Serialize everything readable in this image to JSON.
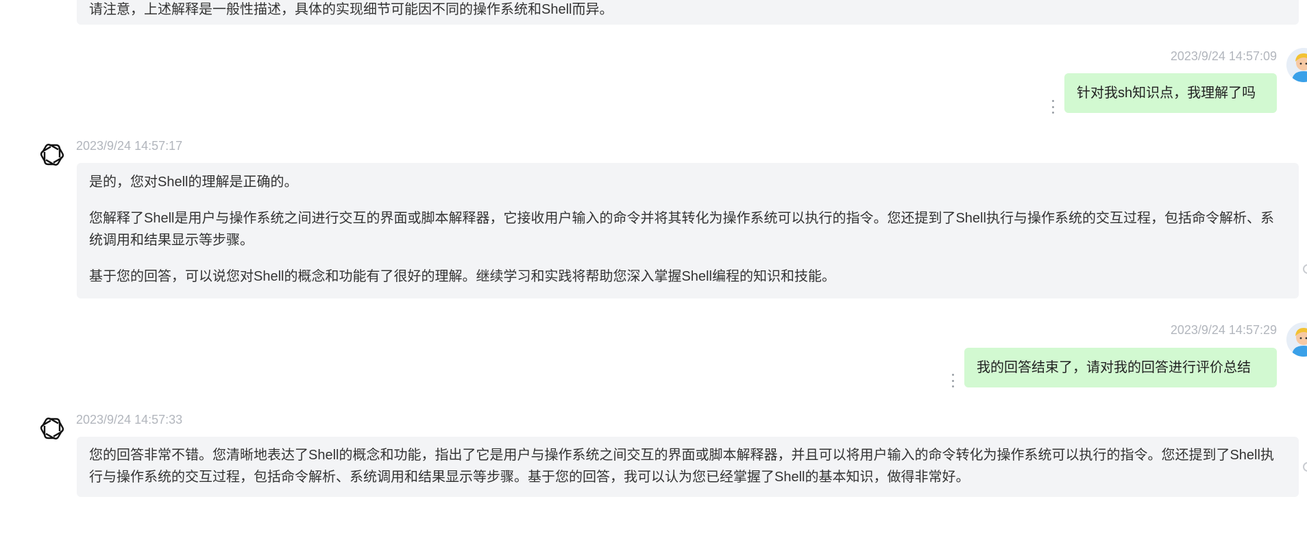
{
  "messages": {
    "ai0": {
      "text": "请注意，上述解释是一般性描述，具体的实现细节可能因不同的操作系统和Shell而异。"
    },
    "user1": {
      "timestamp": "2023/9/24 14:57:09",
      "text": "针对我sh知识点，我理解了吗"
    },
    "ai1": {
      "timestamp": "2023/9/24 14:57:17",
      "paragraphs": [
        "是的，您对Shell的理解是正确的。",
        "您解释了Shell是用户与操作系统之间进行交互的界面或脚本解释器，它接收用户输入的命令并将其转化为操作系统可以执行的指令。您还提到了Shell执行与操作系统的交互过程，包括命令解析、系统调用和结果显示等步骤。",
        "基于您的回答，可以说您对Shell的概念和功能有了很好的理解。继续学习和实践将帮助您深入掌握Shell编程的知识和技能。"
      ]
    },
    "user2": {
      "timestamp": "2023/9/24 14:57:29",
      "text": "我的回答结束了，请对我的回答进行评价总结"
    },
    "ai2": {
      "timestamp": "2023/9/24 14:57:33",
      "text": "您的回答非常不错。您清晰地表达了Shell的概念和功能，指出了它是用户与操作系统之间交互的界面或脚本解释器，并且可以将用户输入的命令转化为操作系统可以执行的指令。您还提到了Shell执行与操作系统的交互过程，包括命令解析、系统调用和结果显示等步骤。基于您的回答，我可以认为您已经掌握了Shell的基本知识，做得非常好。"
    }
  },
  "icons": {
    "assistant": "openai-logo-icon",
    "user": "user-avatar",
    "menu": "more-vertical-icon"
  },
  "colors": {
    "ai_bubble": "#f3f4f6",
    "user_bubble": "#d2f9d1",
    "timestamp": "#b2b6bd"
  }
}
